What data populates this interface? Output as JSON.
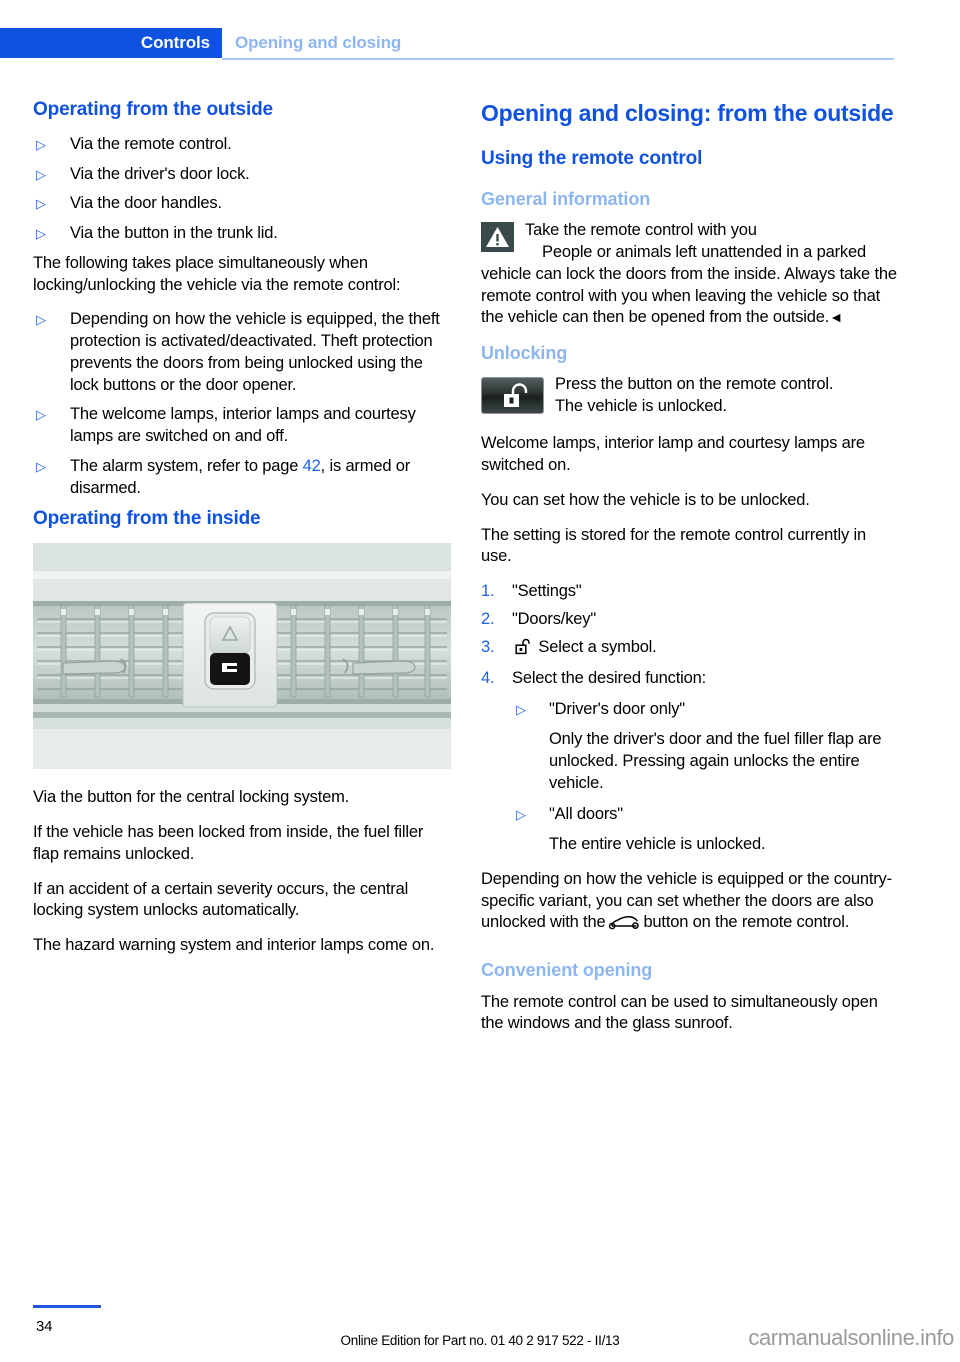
{
  "header": {
    "chapter": "Controls",
    "section": "Opening and closing"
  },
  "left_column": {
    "heading_outside": "Operating from the outside",
    "outside_bullets": [
      "Via the remote control.",
      "Via the driver's door lock.",
      "Via the door handles.",
      "Via the button in the trunk lid."
    ],
    "intro_paragraph": "The following takes place simultaneously when locking/unlocking the vehicle via the remote control:",
    "simultaneous_bullets": [
      "Depending on how the vehicle is equipped, the theft protection is activated/deactivated. Theft protection prevents the doors from being unlocked using the lock buttons or the door opener.",
      "The welcome lamps, interior lamps and courtesy lamps are switched on and off."
    ],
    "alarm_bullet_prefix": "The alarm system, refer to page ",
    "alarm_page_ref": "42",
    "alarm_bullet_suffix": ", is armed or disarmed.",
    "heading_inside": "Operating from the inside",
    "figure_name": "central-locking-button-dashboard",
    "after_figure": [
      "Via the button for the central locking system.",
      "If the vehicle has been locked from inside, the fuel filler flap remains unlocked.",
      "If an accident of a certain severity occurs, the central locking system unlocks automatically.",
      "The hazard warning system and interior lamps come on."
    ]
  },
  "right_column": {
    "title": "Opening and closing: from the outside",
    "subheading": "Using the remote control",
    "general_information_heading": "General information",
    "warning": {
      "icon": "warning-triangle-icon",
      "title": "Take the remote control with you",
      "body": "People or animals left unattended in a parked vehicle can lock the doors from the inside. Always take the remote control with you when leaving the vehicle so that the vehicle can then be opened from the outside.",
      "end_mark": "◄"
    },
    "unlocking_heading": "Unlocking",
    "unlock_key": {
      "icon": "unlock-padlock-button-icon",
      "line1": "Press the button on the remote control.",
      "line2": "The vehicle is unlocked."
    },
    "paragraphs_after_key": [
      "Welcome lamps, interior lamp and courtesy lamps are switched on.",
      "You can set how the vehicle is to be unlocked.",
      "The setting is stored for the remote control currently in use."
    ],
    "steps": [
      {
        "num": "1.",
        "text": "\"Settings\"",
        "icon": null
      },
      {
        "num": "2.",
        "text": "\"Doors/key\"",
        "icon": null
      },
      {
        "num": "3.",
        "text": "Select a symbol.",
        "icon": "open-padlock-icon"
      },
      {
        "num": "4.",
        "text": "Select the desired function:",
        "icon": null
      }
    ],
    "function_options": [
      {
        "label": "\"Driver's door only\"",
        "note": "Only the driver's door and the fuel filler flap are unlocked. Pressing again unlocks the entire vehicle."
      },
      {
        "label": "\"All doors\"",
        "note": "The entire vehicle is unlocked."
      }
    ],
    "depending_prefix": "Depending on how the vehicle is equipped or the country-specific variant, you can set whether the doors are also unlocked with the",
    "depending_icon": "car-trunk-icon",
    "depending_suffix": "button on the remote control.",
    "convenient_heading": "Convenient opening",
    "convenient_body": "The remote control can be used to simultaneously open the windows and the glass sunroof."
  },
  "footer": {
    "page_number": "34",
    "edition": "Online Edition for Part no. 01 40 2 917 522 - II/13",
    "watermark": "carmanualsonline.info"
  },
  "colors": {
    "header_blue": "#0f52e0",
    "light_blue": "#8db6f0",
    "accent_blue": "#1a62e8",
    "warning_icon_bg": "#3a4a4a"
  }
}
